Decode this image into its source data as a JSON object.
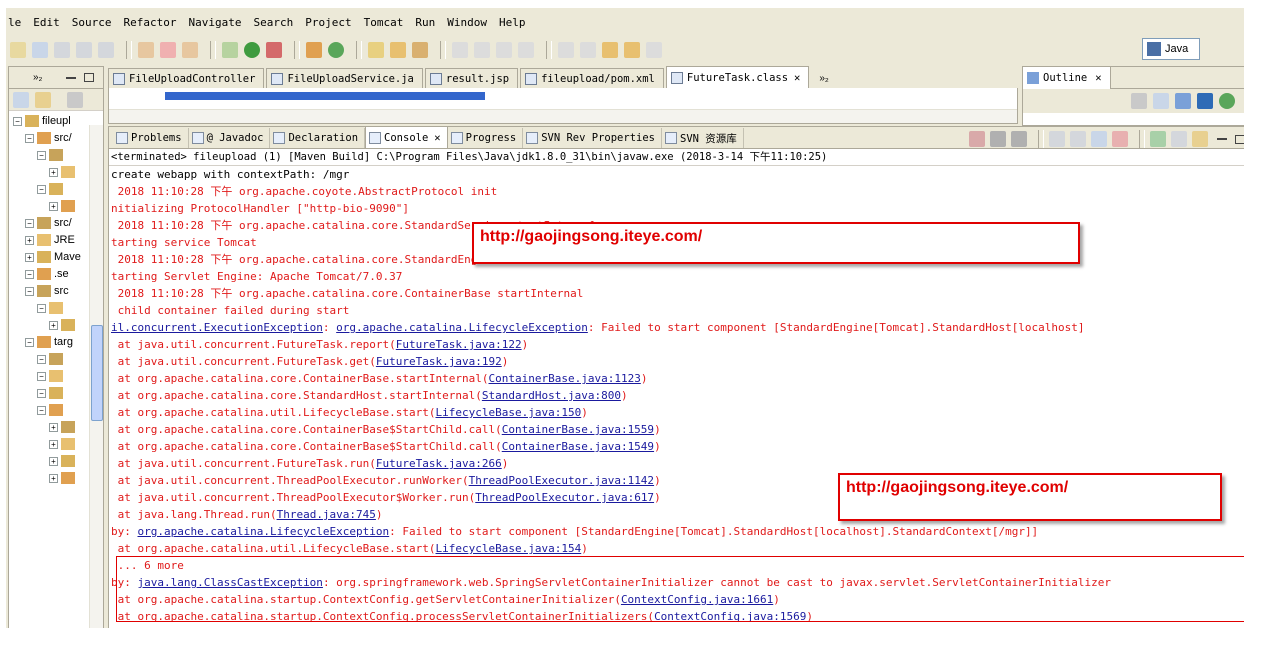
{
  "menu": [
    "le",
    "Edit",
    "Source",
    "Refactor",
    "Navigate",
    "Search",
    "Project",
    "Tomcat",
    "Run",
    "Window",
    "Help"
  ],
  "perspective": {
    "label": "Java"
  },
  "explorer": {
    "rows": [
      {
        "text": "fileupl",
        "depth": 0
      },
      {
        "text": "src/",
        "depth": 1
      },
      {
        "text": "",
        "depth": 2
      },
      {
        "text": "",
        "depth": 3
      },
      {
        "text": "",
        "depth": 2
      },
      {
        "text": "",
        "depth": 3
      },
      {
        "text": "src/",
        "depth": 1
      },
      {
        "text": "JRE",
        "depth": 1
      },
      {
        "text": "Mave",
        "depth": 1
      },
      {
        "text": ".se",
        "depth": 1
      },
      {
        "text": "src",
        "depth": 1
      },
      {
        "text": "",
        "depth": 2
      },
      {
        "text": "",
        "depth": 3
      },
      {
        "text": "targ",
        "depth": 1
      },
      {
        "text": "",
        "depth": 2
      },
      {
        "text": "",
        "depth": 2
      },
      {
        "text": "",
        "depth": 2
      },
      {
        "text": "",
        "depth": 2
      },
      {
        "text": "",
        "depth": 3
      },
      {
        "text": "",
        "depth": 3
      },
      {
        "text": "",
        "depth": 3
      },
      {
        "text": "",
        "depth": 3
      }
    ]
  },
  "editor": {
    "tabs": [
      "FileUploadController",
      "FileUploadService.ja",
      "result.jsp",
      "fileupload/pom.xml",
      "FutureTask.class"
    ],
    "overflow": "»₂"
  },
  "outline": {
    "title": "Outline"
  },
  "console": {
    "tabs": [
      "Problems",
      "@ Javadoc",
      "Declaration",
      "Console",
      "Progress",
      "SVN Rev Properties",
      "SVN 资源库"
    ],
    "status": "<terminated> fileupload (1) [Maven Build] C:\\Program Files\\Java\\jdk1.8.0_31\\bin\\javaw.exe (2018-3-14 下午11:10:25)",
    "lines": [
      {
        "c": "k",
        "t": "create webapp with contextPath: /mgr"
      },
      {
        "c": "r",
        "t": " 2018 11:10:28 下午 org.apache.coyote.AbstractProtocol init"
      },
      {
        "c": "r",
        "t": "nitializing ProtocolHandler [\"http-bio-9090\"]"
      },
      {
        "c": "r",
        "t": " 2018 11:10:28 下午 org.apache.catalina.core.StandardService startInternal"
      },
      {
        "c": "r",
        "t": "tarting service Tomcat"
      },
      {
        "c": "r",
        "t": " 2018 11:10:28 下午 org.apache.catalina.core.StandardEngine startInternal"
      },
      {
        "c": "r",
        "t": "tarting Servlet Engine: Apache Tomcat/7.0.37"
      },
      {
        "c": "r",
        "t": " 2018 11:10:28 下午 org.apache.catalina.core.ContainerBase startInternal"
      },
      {
        "c": "r",
        "t": " child container failed during start"
      },
      {
        "c": "r",
        "pre": "il.concurrent.ExecutionException",
        "mid": ": ",
        "lk": "org.apache.catalina.LifecycleException",
        "post": ": Failed to start component [StandardEngine[Tomcat].StandardHost[localhost]"
      },
      {
        "c": "r",
        "pre": " at java.util.concurrent.FutureTask.report(",
        "lk": "FutureTask.java:122",
        "post": ")"
      },
      {
        "c": "r",
        "pre": " at java.util.concurrent.FutureTask.get(",
        "lk": "FutureTask.java:192",
        "post": ")"
      },
      {
        "c": "r",
        "pre": " at org.apache.catalina.core.ContainerBase.startInternal(",
        "lk": "ContainerBase.java:1123",
        "post": ")"
      },
      {
        "c": "r",
        "pre": " at org.apache.catalina.core.StandardHost.startInternal(",
        "lk": "StandardHost.java:800",
        "post": ")"
      },
      {
        "c": "r",
        "pre": " at org.apache.catalina.util.LifecycleBase.start(",
        "lk": "LifecycleBase.java:150",
        "post": ")"
      },
      {
        "c": "r",
        "pre": " at org.apache.catalina.core.ContainerBase$StartChild.call(",
        "lk": "ContainerBase.java:1559",
        "post": ")"
      },
      {
        "c": "r",
        "pre": " at org.apache.catalina.core.ContainerBase$StartChild.call(",
        "lk": "ContainerBase.java:1549",
        "post": ")"
      },
      {
        "c": "r",
        "pre": " at java.util.concurrent.FutureTask.run(",
        "lk": "FutureTask.java:266",
        "post": ")"
      },
      {
        "c": "r",
        "pre": " at java.util.concurrent.ThreadPoolExecutor.runWorker(",
        "lk": "ThreadPoolExecutor.java:1142",
        "post": ")"
      },
      {
        "c": "r",
        "pre": " at java.util.concurrent.ThreadPoolExecutor$Worker.run(",
        "lk": "ThreadPoolExecutor.java:617",
        "post": ")"
      },
      {
        "c": "r",
        "pre": " at java.lang.Thread.run(",
        "lk": "Thread.java:745",
        "post": ")"
      },
      {
        "c": "r",
        "pre": "by: ",
        "lk": "org.apache.catalina.LifecycleException",
        "post": ": Failed to start component [StandardEngine[Tomcat].StandardHost[localhost].StandardContext[/mgr]]"
      },
      {
        "c": "r",
        "pre": " at org.apache.catalina.util.LifecycleBase.start(",
        "lk": "LifecycleBase.java:154",
        "post": ")"
      },
      {
        "c": "r",
        "t": " ... 6 more"
      },
      {
        "c": "r",
        "pre": "by: ",
        "lk": "java.lang.ClassCastException",
        "post": ": org.springframework.web.SpringServletContainerInitializer cannot be cast to javax.servlet.ServletContainerInitializer"
      },
      {
        "c": "r",
        "pre": " at org.apache.catalina.startup.ContextConfig.getServletContainerInitializer(",
        "lk": "ContextConfig.java:1661",
        "post": ")"
      },
      {
        "c": "r",
        "pre": " at org.apache.catalina.startup.ContextConfig.processServletContainerInitializers(",
        "lk": "ContextConfig.java:1569",
        "post": ")"
      }
    ]
  },
  "watermarks": [
    "http://gaojingsong.iteye.com/",
    "http://gaojingsong.iteye.com/"
  ],
  "colors": {
    "error": "#e01a1a",
    "link": "#1a1a9e",
    "chrome": "#ece9d8",
    "annotation": "#e00000"
  }
}
